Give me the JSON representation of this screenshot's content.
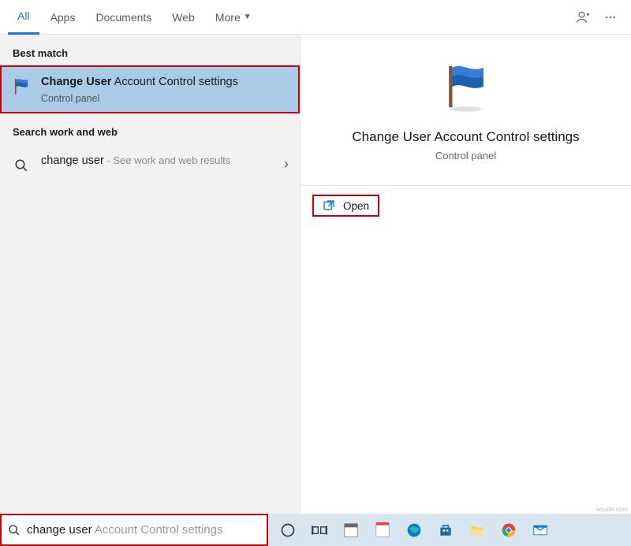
{
  "tabs": {
    "all": "All",
    "apps": "Apps",
    "documents": "Documents",
    "web": "Web",
    "more": "More"
  },
  "sections": {
    "best_match": "Best match",
    "search_web": "Search work and web"
  },
  "best_match_item": {
    "title_bold": "Change User",
    "title_rest": " Account Control settings",
    "subtitle": "Control panel"
  },
  "web_item": {
    "query": "change user",
    "suffix": " - See work and web results"
  },
  "preview": {
    "title": "Change User Account Control settings",
    "subtitle": "Control panel"
  },
  "actions": {
    "open": "Open"
  },
  "search": {
    "typed": "change user",
    "ghost": " Account Control settings"
  },
  "watermark": "wsxdn.com"
}
